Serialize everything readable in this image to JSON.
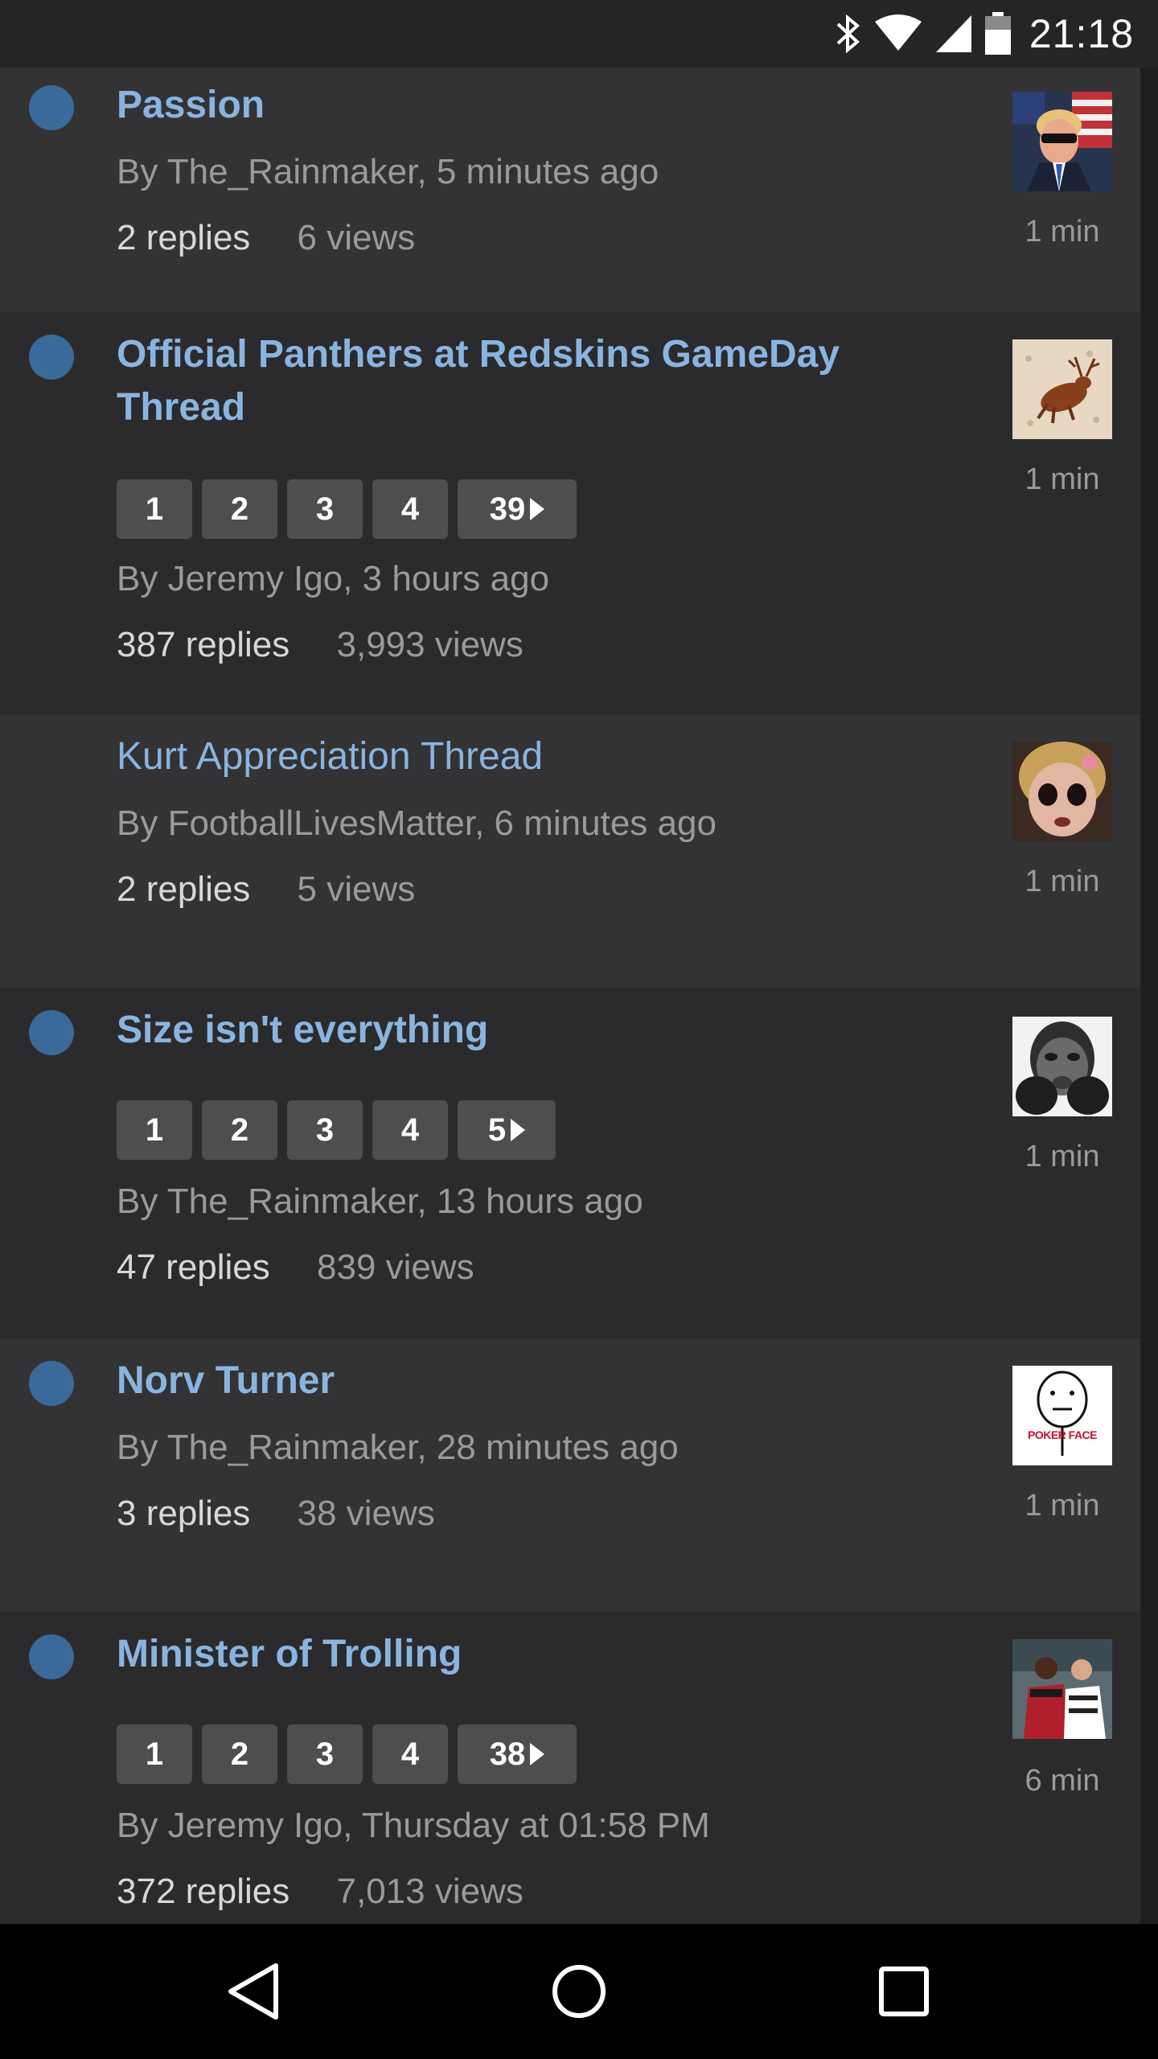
{
  "status_bar": {
    "time": "21:18",
    "icons": [
      "bluetooth-icon",
      "wifi-icon",
      "cell-signal-icon",
      "battery-icon"
    ]
  },
  "colors": {
    "background": "#2b2b2d",
    "row_alt": "#333335",
    "link": "#8ab4e0",
    "unread_dot": "#3a6a9a",
    "page_button": "#4e4e50"
  },
  "topics": [
    {
      "title": "Passion",
      "unread": true,
      "pages": [],
      "byline": "By The_Rainmaker, 5 minutes ago",
      "replies": "2 replies",
      "views": "6 views",
      "last_reply_age": "1 min",
      "avatar": "trump-sunglasses-avatar"
    },
    {
      "title": "Official Panthers at Redskins GameDay Thread",
      "unread": true,
      "pages": [
        "1",
        "2",
        "3",
        "4",
        "39"
      ],
      "byline": "By Jeremy Igo, 3 hours ago",
      "replies": "387 replies",
      "views": "3,993 views",
      "last_reply_age": "1 min",
      "avatar": "deer-avatar"
    },
    {
      "title": "Kurt Appreciation Thread",
      "unread": false,
      "pages": [],
      "byline": "By FootballLivesMatter, 6 minutes ago",
      "replies": "2 replies",
      "views": "5 views",
      "last_reply_age": "1 min",
      "avatar": "creepy-doll-avatar"
    },
    {
      "title": "Size isn't everything",
      "unread": true,
      "pages": [
        "1",
        "2",
        "3",
        "4",
        "5"
      ],
      "byline": "By The_Rainmaker, 13 hours ago",
      "replies": "47 replies",
      "views": "839 views",
      "last_reply_age": "1 min",
      "avatar": "boxer-avatar"
    },
    {
      "title": "Norv Turner",
      "unread": true,
      "pages": [],
      "byline": "By The_Rainmaker, 28 minutes ago",
      "replies": "3 replies",
      "views": "38 views",
      "last_reply_age": "1 min",
      "avatar": "poker-face-avatar",
      "avatar_text": "POKER FACE"
    },
    {
      "title": "Minister of Trolling",
      "unread": true,
      "pages": [
        "1",
        "2",
        "3",
        "4",
        "38"
      ],
      "byline": "By Jeremy Igo, Thursday at 01:58 PM",
      "replies": "372 replies",
      "views": "7,013 views",
      "last_reply_age": "6 min",
      "avatar": "football-players-avatar"
    }
  ],
  "nav_bar": {
    "buttons": [
      "back-icon",
      "home-icon",
      "recents-icon"
    ]
  }
}
